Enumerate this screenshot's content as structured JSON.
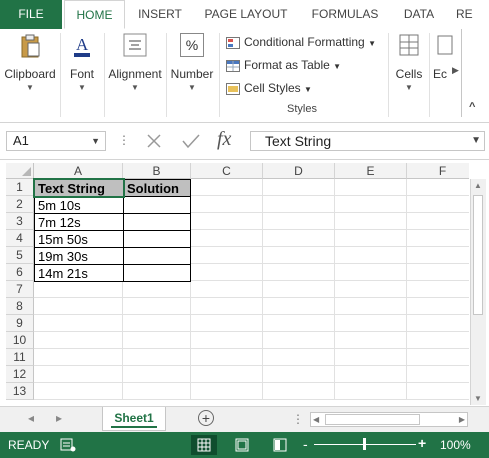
{
  "ribbon_tabs": [
    "FILE",
    "HOME",
    "INSERT",
    "PAGE LAYOUT",
    "FORMULAS",
    "DATA",
    "RE"
  ],
  "ribbon": {
    "clipboard": "Clipboard",
    "font": "Font",
    "alignment": "Alignment",
    "number": "Number",
    "number_symbol": "%",
    "conditional_formatting": "Conditional Formatting",
    "format_as_table": "Format as Table",
    "cell_styles": "Cell Styles",
    "styles_group": "Styles",
    "cells": "Cells",
    "editing": "Ec",
    "collapse": "^"
  },
  "formula_bar": {
    "name_box": "A1",
    "fx_label": "fx",
    "content": "Text String"
  },
  "grid": {
    "columns": [
      "A",
      "B",
      "C",
      "D",
      "E",
      "F"
    ],
    "rows": [
      "1",
      "2",
      "3",
      "4",
      "5",
      "6",
      "7",
      "8",
      "9",
      "10",
      "11",
      "12",
      "13"
    ],
    "cells": {
      "A1": "Text String",
      "B1": "Solution",
      "A2": "5m  10s",
      "A3": "7m  12s",
      "A4": "15m  50s",
      "A5": "19m  30s",
      "A6": "14m  21s"
    }
  },
  "sheets": {
    "active": "Sheet1",
    "add": "+"
  },
  "status_bar": {
    "ready": "READY",
    "zoom": "100%",
    "minus": "-",
    "plus": "+"
  },
  "colors": {
    "accent": "#217346",
    "header_fill": "#bfbfbf"
  }
}
